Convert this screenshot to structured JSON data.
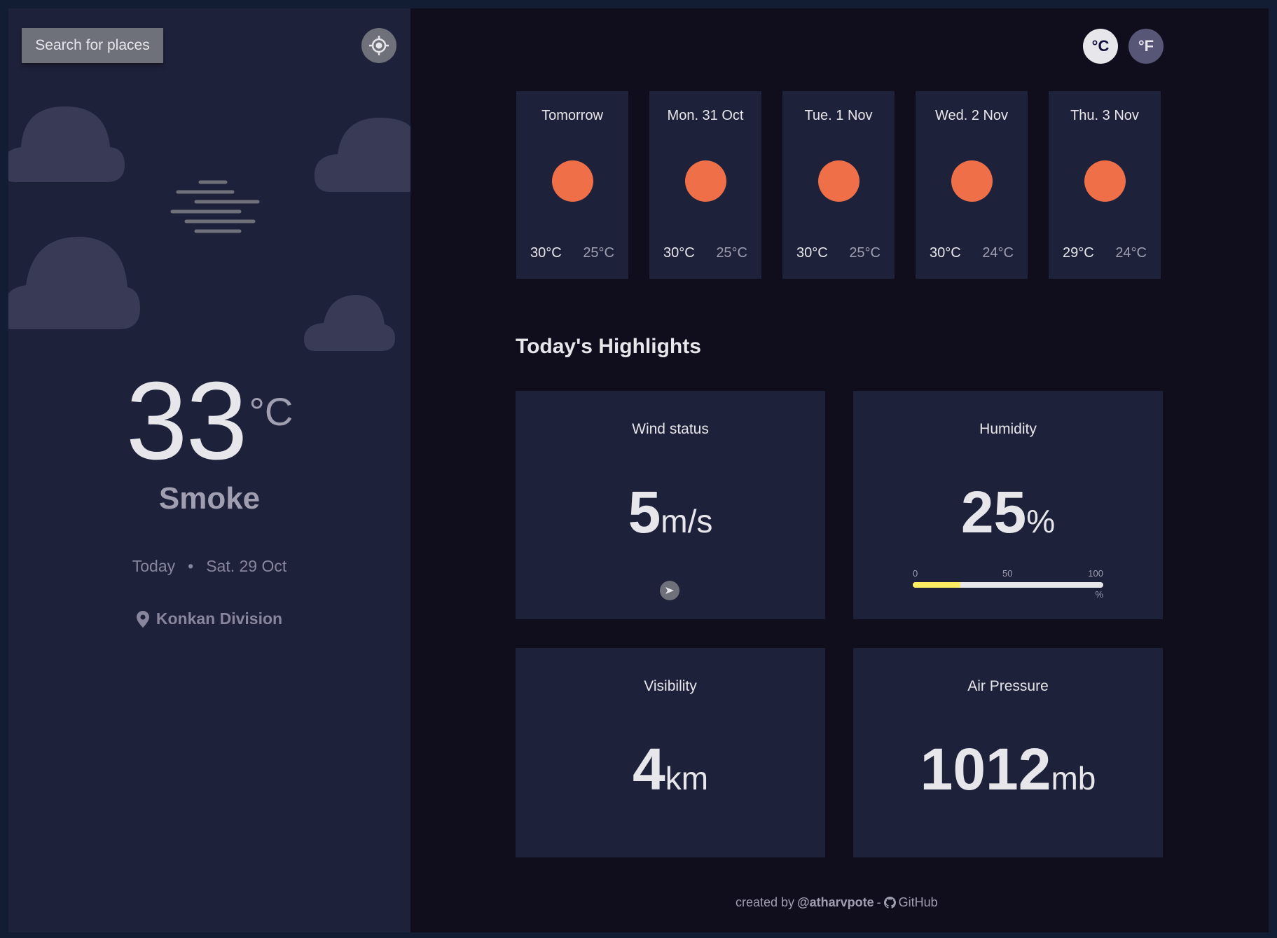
{
  "sidebar": {
    "search_label": "Search for places",
    "locate_icon": "crosshair-icon",
    "temperature": "33",
    "temperature_unit": "°C",
    "condition": "Smoke",
    "date_label": "Today",
    "date_separator": "•",
    "date": "Sat. 29 Oct",
    "location": "Konkan Division",
    "location_icon": "map-pin-icon",
    "weather_icon": "haze-icon"
  },
  "units": {
    "celsius": "°C",
    "fahrenheit": "°F",
    "active": "celsius"
  },
  "forecast": [
    {
      "day": "Tomorrow",
      "max": "30°C",
      "min": "25°C",
      "icon": "sun-icon"
    },
    {
      "day": "Mon. 31 Oct",
      "max": "30°C",
      "min": "25°C",
      "icon": "sun-icon"
    },
    {
      "day": "Tue. 1 Nov",
      "max": "30°C",
      "min": "25°C",
      "icon": "sun-icon"
    },
    {
      "day": "Wed. 2 Nov",
      "max": "30°C",
      "min": "24°C",
      "icon": "sun-icon"
    },
    {
      "day": "Thu. 3 Nov",
      "max": "29°C",
      "min": "24°C",
      "icon": "sun-icon"
    }
  ],
  "highlights": {
    "title": "Today's Highlights",
    "wind": {
      "label": "Wind status",
      "value": "5",
      "unit": "m/s",
      "direction_icon": "navigation-arrow-icon"
    },
    "humidity": {
      "label": "Humidity",
      "value": "25",
      "unit": "%",
      "scale": [
        "0",
        "50",
        "100"
      ],
      "scale_unit": "%",
      "fill_percent": 25
    },
    "visibility": {
      "label": "Visibility",
      "value": "4",
      "unit": "km"
    },
    "pressure": {
      "label": "Air Pressure",
      "value": "1012",
      "unit": "mb"
    }
  },
  "footer": {
    "prefix": "created by",
    "author": "@atharvpote",
    "separator": "-",
    "link_label": "GitHub",
    "link_icon": "github-icon"
  },
  "colors": {
    "sidebar_bg": "#1e213a",
    "main_bg": "#100e1d",
    "sun": "#ef6f48",
    "humidity_fill": "#ffec65"
  }
}
